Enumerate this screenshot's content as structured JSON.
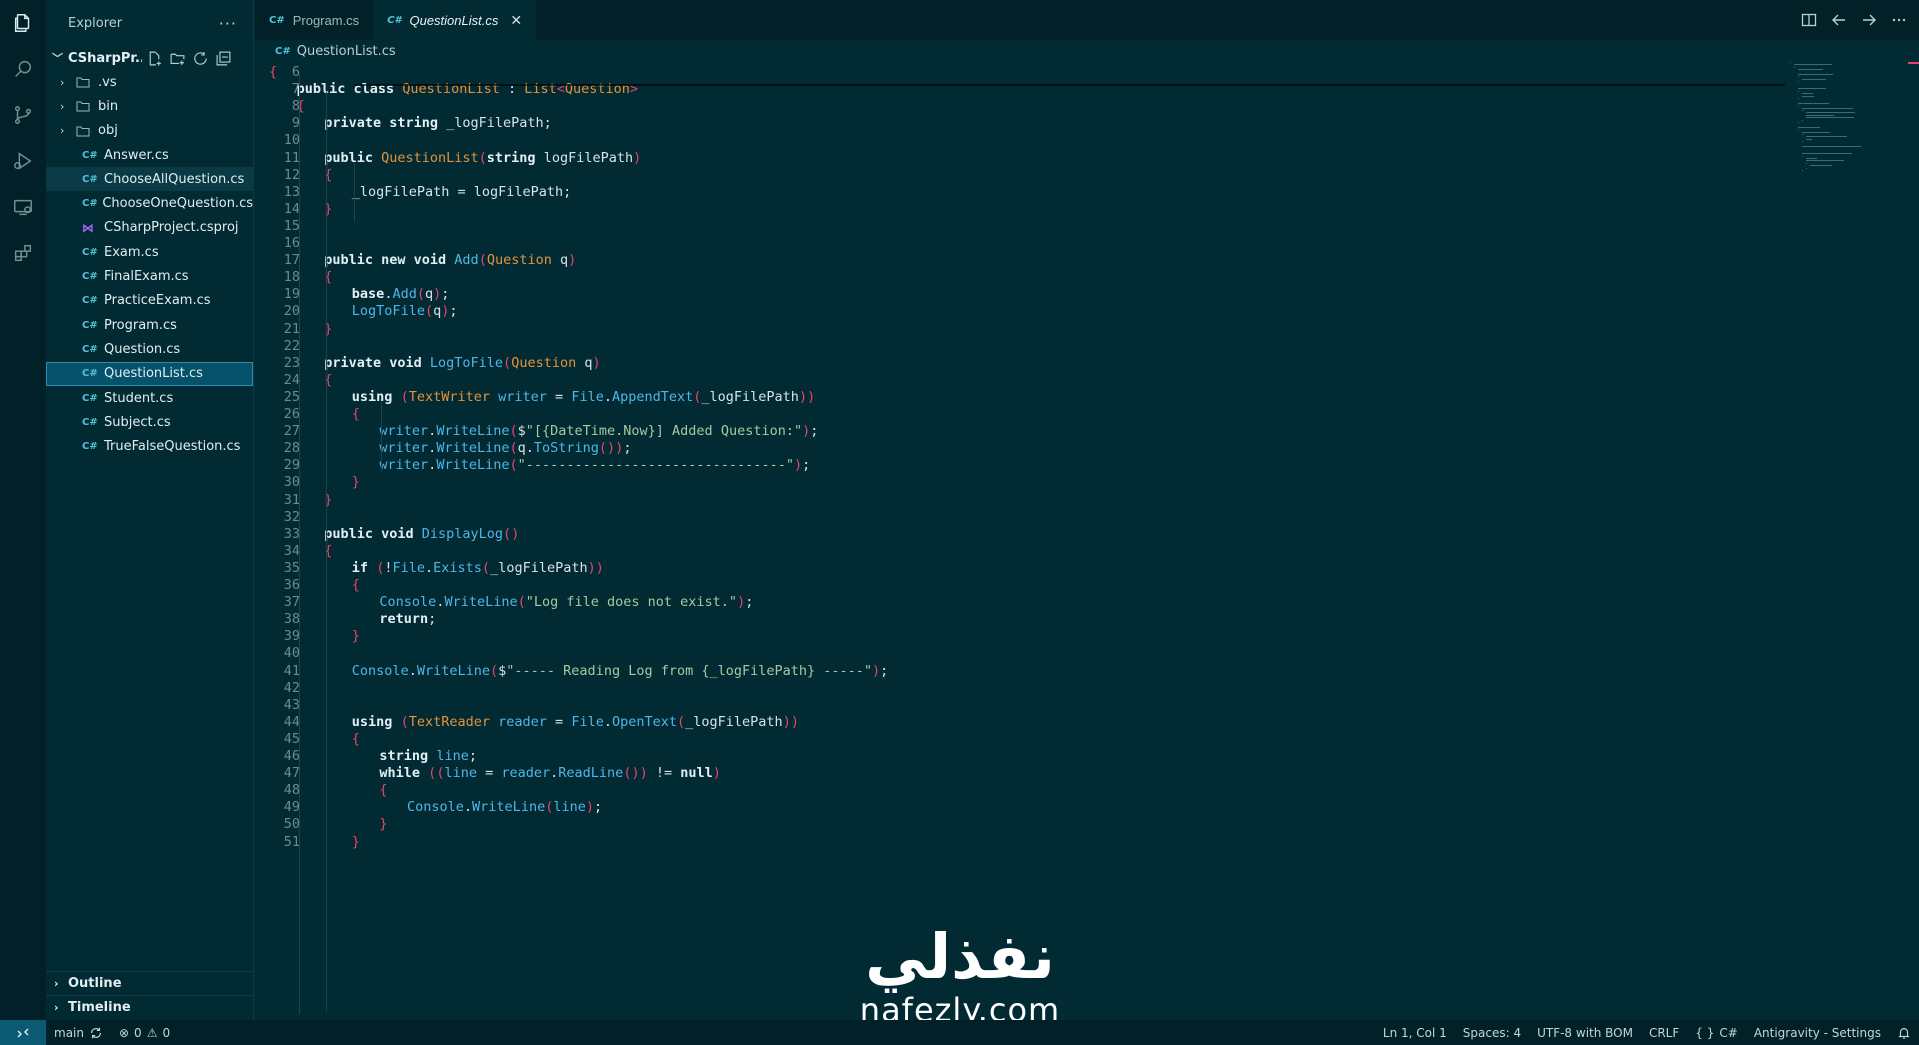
{
  "activity_bar": {
    "icons": [
      "files-icon",
      "search-icon",
      "source-control-icon",
      "run-debug-icon",
      "remote-explorer-icon",
      "extensions-icon"
    ]
  },
  "sidebar": {
    "title": "Explorer",
    "more": "···",
    "project_name": "CSharpPr...",
    "folders": [
      ".vs",
      "bin",
      "obj"
    ],
    "files": [
      {
        "name": "Answer.cs",
        "kind": "cs"
      },
      {
        "name": "ChooseAllQuestion.cs",
        "kind": "cs"
      },
      {
        "name": "ChooseOneQuestion.cs",
        "kind": "cs"
      },
      {
        "name": "CSharpProject.csproj",
        "kind": "proj"
      },
      {
        "name": "Exam.cs",
        "kind": "cs"
      },
      {
        "name": "FinalExam.cs",
        "kind": "cs"
      },
      {
        "name": "PracticeExam.cs",
        "kind": "cs"
      },
      {
        "name": "Program.cs",
        "kind": "cs"
      },
      {
        "name": "Question.cs",
        "kind": "cs"
      },
      {
        "name": "QuestionList.cs",
        "kind": "cs"
      },
      {
        "name": "Student.cs",
        "kind": "cs"
      },
      {
        "name": "Subject.cs",
        "kind": "cs"
      },
      {
        "name": "TrueFalseQuestion.cs",
        "kind": "cs"
      }
    ],
    "cs_badge": "C#",
    "project_badge": "⋈",
    "outline": "Outline",
    "timeline": "Timeline"
  },
  "tabs": [
    {
      "label": "Program.cs",
      "active": false
    },
    {
      "label": "QuestionList.cs",
      "active": true
    }
  ],
  "breadcrumb": "QuestionList.cs",
  "editor": {
    "lines": [
      {
        "n": "6",
        "indent": 0,
        "text": "{"
      },
      {
        "n": "7",
        "indent": 1,
        "text": "public class QuestionList : List<Question>"
      },
      {
        "n": "8",
        "indent": 1,
        "text": "{"
      },
      {
        "n": "9",
        "indent": 2,
        "text": "private string _logFilePath;"
      },
      {
        "n": "10",
        "indent": 0,
        "text": ""
      },
      {
        "n": "11",
        "indent": 2,
        "text": "public QuestionList(string logFilePath)"
      },
      {
        "n": "12",
        "indent": 2,
        "text": "{"
      },
      {
        "n": "13",
        "indent": 3,
        "text": "_logFilePath = logFilePath;"
      },
      {
        "n": "14",
        "indent": 2,
        "text": "}"
      },
      {
        "n": "15",
        "indent": 0,
        "text": ""
      },
      {
        "n": "16",
        "indent": 0,
        "text": ""
      },
      {
        "n": "17",
        "indent": 2,
        "text": "public new void Add(Question q)"
      },
      {
        "n": "18",
        "indent": 2,
        "text": "{"
      },
      {
        "n": "19",
        "indent": 3,
        "text": "base.Add(q);"
      },
      {
        "n": "20",
        "indent": 3,
        "text": "LogToFile(q);"
      },
      {
        "n": "21",
        "indent": 2,
        "text": "}"
      },
      {
        "n": "22",
        "indent": 0,
        "text": ""
      },
      {
        "n": "23",
        "indent": 2,
        "text": "private void LogToFile(Question q)"
      },
      {
        "n": "24",
        "indent": 2,
        "text": "{"
      },
      {
        "n": "25",
        "indent": 3,
        "text": "using (TextWriter writer = File.AppendText(_logFilePath))"
      },
      {
        "n": "26",
        "indent": 3,
        "text": "{"
      },
      {
        "n": "27",
        "indent": 4,
        "text": "writer.WriteLine($\"[{DateTime.Now}] Added Question:\");"
      },
      {
        "n": "28",
        "indent": 4,
        "text": "writer.WriteLine(q.ToString());"
      },
      {
        "n": "29",
        "indent": 4,
        "text": "writer.WriteLine(\"--------------------------------\");"
      },
      {
        "n": "30",
        "indent": 3,
        "text": "}"
      },
      {
        "n": "31",
        "indent": 2,
        "text": "}"
      },
      {
        "n": "32",
        "indent": 0,
        "text": ""
      },
      {
        "n": "33",
        "indent": 2,
        "text": "public void DisplayLog()"
      },
      {
        "n": "34",
        "indent": 2,
        "text": "{"
      },
      {
        "n": "35",
        "indent": 3,
        "text": "if (!File.Exists(_logFilePath))"
      },
      {
        "n": "36",
        "indent": 3,
        "text": "{"
      },
      {
        "n": "37",
        "indent": 4,
        "text": "Console.WriteLine(\"Log file does not exist.\");"
      },
      {
        "n": "38",
        "indent": 4,
        "text": "return;"
      },
      {
        "n": "39",
        "indent": 3,
        "text": "}"
      },
      {
        "n": "40",
        "indent": 0,
        "text": ""
      },
      {
        "n": "41",
        "indent": 3,
        "text": "Console.WriteLine($\"----- Reading Log from {_logFilePath} -----\");"
      },
      {
        "n": "42",
        "indent": 0,
        "text": ""
      },
      {
        "n": "43",
        "indent": 0,
        "text": ""
      },
      {
        "n": "44",
        "indent": 3,
        "text": "using (TextReader reader = File.OpenText(_logFilePath))"
      },
      {
        "n": "45",
        "indent": 3,
        "text": "{"
      },
      {
        "n": "46",
        "indent": 4,
        "text": "string line;"
      },
      {
        "n": "47",
        "indent": 4,
        "text": "while ((line = reader.ReadLine()) != null)"
      },
      {
        "n": "48",
        "indent": 4,
        "text": "{"
      },
      {
        "n": "49",
        "indent": 5,
        "text": "Console.WriteLine(line);"
      },
      {
        "n": "50",
        "indent": 4,
        "text": "}"
      },
      {
        "n": "51",
        "indent": 3,
        "text": "}"
      }
    ]
  },
  "watermark": {
    "arabic": "نفذلي",
    "latin": "nafezly.com"
  },
  "statusbar": {
    "branch": "main",
    "errors": "0",
    "warnings": "0",
    "position": "Ln 1, Col 1",
    "spaces": "Spaces: 4",
    "encoding": "UTF-8 with BOM",
    "eol": "CRLF",
    "language": "C#",
    "settings": "Antigravity - Settings"
  },
  "colors": {
    "background": "#022a33",
    "sidebar_selected": "#05526a",
    "keyword": "#e3923a",
    "function": "#4fb6e8",
    "string": "#a6c9a0",
    "bracket": "#e8436b"
  }
}
